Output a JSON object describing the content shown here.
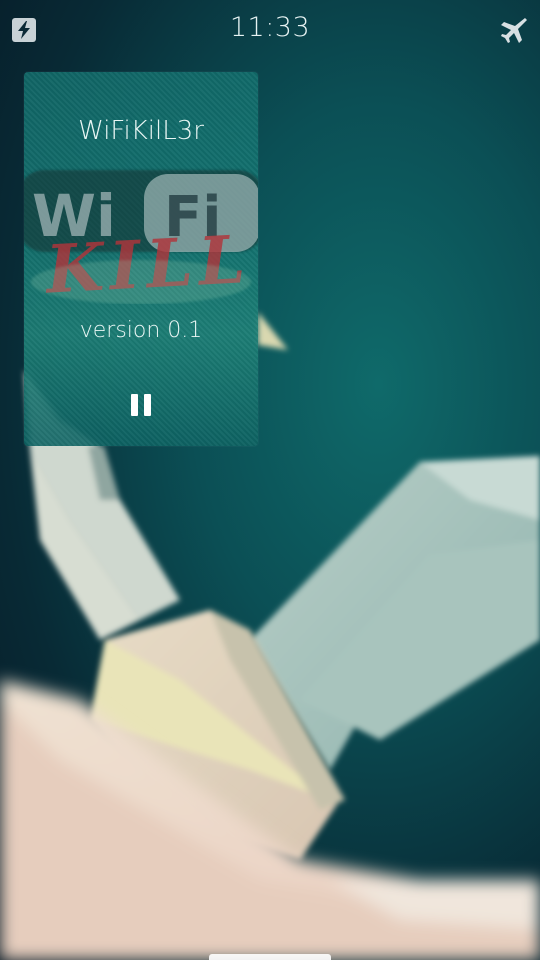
{
  "status_bar": {
    "time": "11:33",
    "left_icon": "charging-icon",
    "right_icon": "flight-mode-icon"
  },
  "app_cover": {
    "title": "WiFiKilL3r",
    "logo": {
      "word_wi": "Wi",
      "word_fi": "Fi",
      "word_kill": "KILL"
    },
    "version": "version 0.1",
    "action_icon": "pause-icon"
  },
  "colors": {
    "background_dark": "#061824",
    "background_teal": "#0f6a6a",
    "cover_teal": "#147672",
    "logo_red": "#b0343a",
    "text_light": "#e9f6f4"
  }
}
